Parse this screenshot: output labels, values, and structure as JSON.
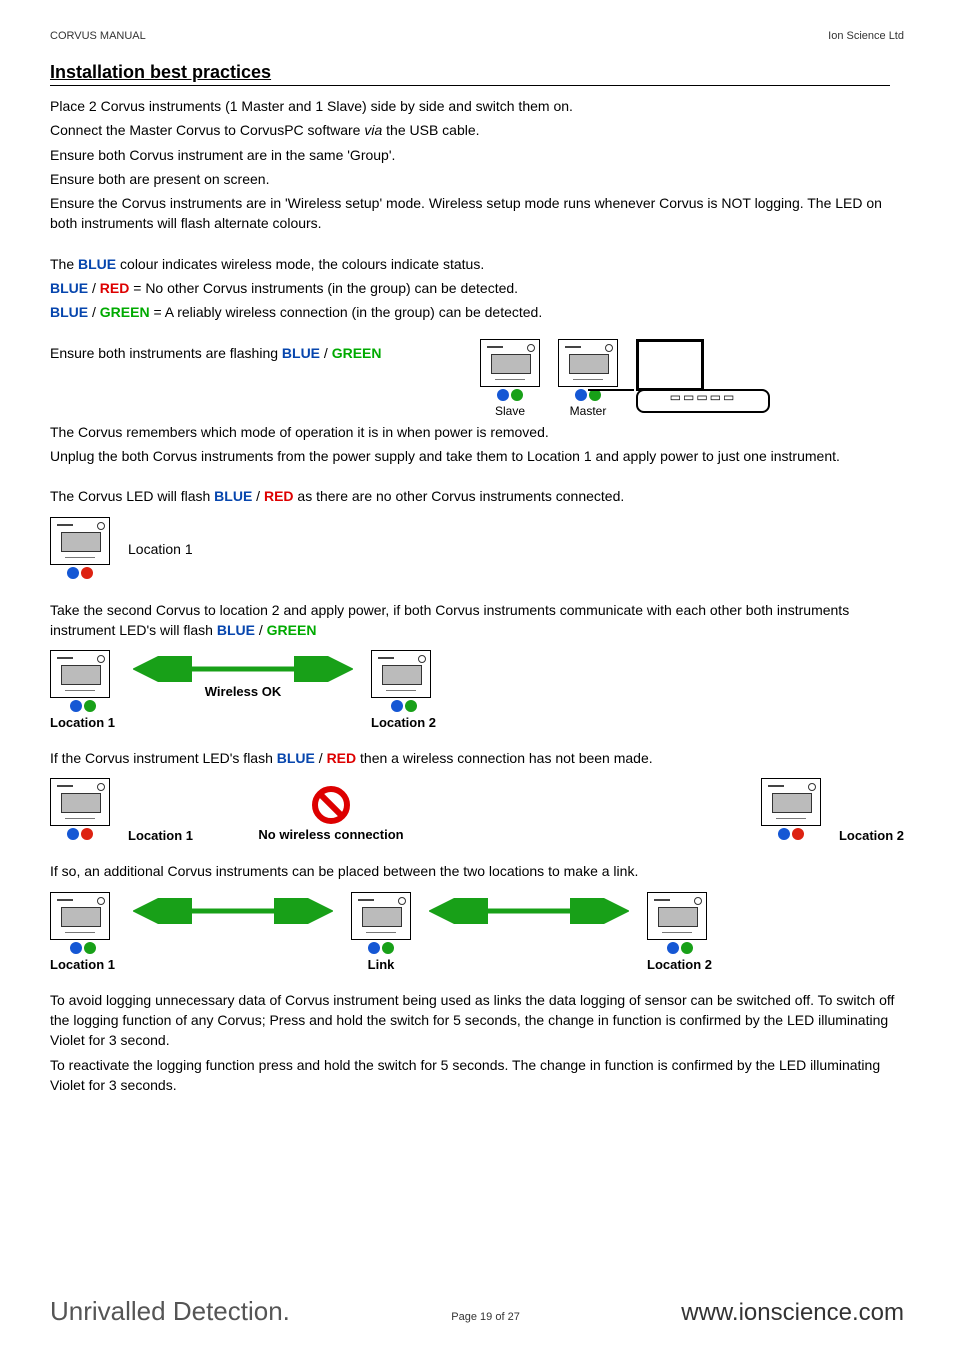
{
  "header": {
    "left": "CORVUS MANUAL",
    "right": "Ion Science Ltd"
  },
  "section_title": "Installation best practices",
  "intro": [
    "Place 2 Corvus instruments (1 Master and 1 Slave) side by side and switch them on.",
    "Connect the Master Corvus to CorvusPC software ",
    "via",
    " the USB cable.",
    "Ensure both Corvus instrument are in the same 'Group'.",
    "Ensure both are present on screen.",
    "Ensure the Corvus instruments are in 'Wireless setup' mode. Wireless setup mode runs whenever Corvus is NOT logging. The LED on both instruments will flash alternate colours."
  ],
  "status_intro": "The ",
  "status_blue_word": "BLUE",
  "status_after_blue": " colour indicates wireless mode, the colours indicate status.",
  "status_blue": "BLUE",
  "status_red": "RED",
  "status_green": "GREEN",
  "status_line1_after": " = No other Corvus instruments (in the group) can be detected.",
  "status_line2_after": " = A reliably wireless connection (in the group) can be detected.",
  "ensure_flashing_pre": "Ensure both instruments are flashing ",
  "slash": " / ",
  "diagram1": {
    "slave": "Slave",
    "master": "Master"
  },
  "remember_p1": "The Corvus remembers which mode of operation it is in when power is removed.",
  "remember_p2": "Unplug the both Corvus instruments from the power supply and take them to Location 1 and apply power to just one instrument.",
  "led_flash_pre": "The Corvus LED will flash ",
  "led_flash_post": " as there are no other Corvus instruments connected.",
  "loc1_label": "Location 1",
  "take_second_pre": "Take the second Corvus to location 2 and apply power, if both Corvus instruments communicate with each other both instruments instrument LED's will flash ",
  "wireless_ok": "Wireless OK",
  "loc2_label": "Location 2",
  "if_red_pre": "If the Corvus instrument LED's flash ",
  "if_red_post": " then a wireless connection has not been made.",
  "no_wireless": "No wireless connection",
  "if_so_extra": "If so, an additional Corvus instruments can be placed between the two locations to make a link.",
  "link_label": "Link",
  "avoid_logging_p1": "To avoid logging unnecessary data of Corvus instrument being used as links the data logging of sensor can be switched off. To switch off the logging function of any Corvus; Press and hold the switch for 5 seconds, the change in function is confirmed by the LED illuminating Violet for 3 second.",
  "avoid_logging_p2": "To reactivate the logging function press and hold the switch for 5 seconds.  The change in function is confirmed by the LED illuminating Violet for 3 seconds.",
  "footer": {
    "left": "Unrivalled Detection.",
    "mid_pre": "Page ",
    "page_no": "19",
    "mid_mid": " of ",
    "page_total": "27",
    "right": "www.ionscience.com"
  }
}
